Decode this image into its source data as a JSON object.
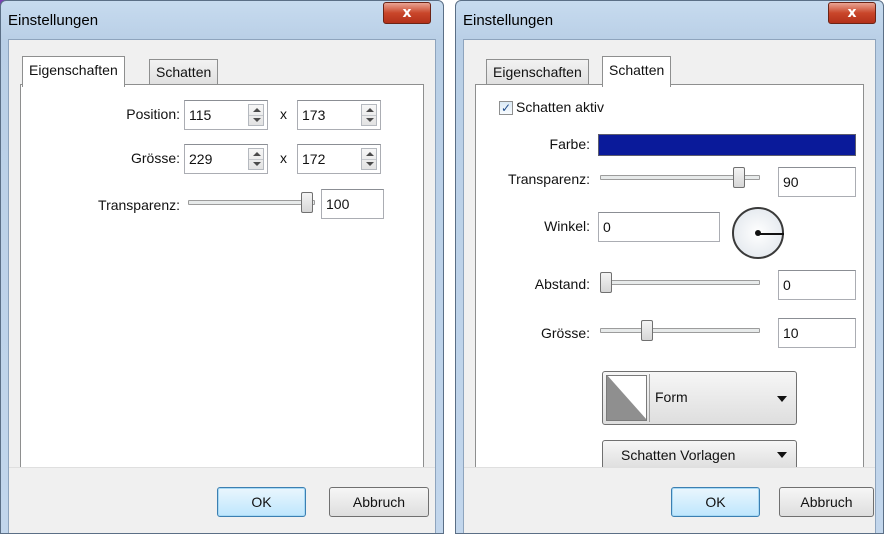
{
  "left_dialog": {
    "title": "Einstellungen",
    "close_glyph": "x",
    "tabs": [
      {
        "label": "Eigenschaften",
        "active": true
      },
      {
        "label": "Schatten",
        "active": false
      }
    ],
    "position": {
      "label": "Position:",
      "x": "115",
      "y": "173"
    },
    "size": {
      "label": "Grösse:",
      "w": "229",
      "h": "172"
    },
    "separator": "x",
    "transparency": {
      "label": "Transparenz:",
      "value": "100",
      "level": 1.0
    },
    "ok_label": "OK",
    "cancel_label": "Abbruch"
  },
  "right_dialog": {
    "title": "Einstellungen",
    "close_glyph": "x",
    "tabs": [
      {
        "label": "Eigenschaften",
        "active": false
      },
      {
        "label": "Schatten",
        "active": true
      }
    ],
    "shadow_active": {
      "label": "Schatten aktiv",
      "checked": true
    },
    "color": {
      "label": "Farbe:",
      "value": "#0a1a9a"
    },
    "transparency": {
      "label": "Transparenz:",
      "value": "90",
      "level": 0.9
    },
    "angle": {
      "label": "Winkel:",
      "value": "0"
    },
    "distance": {
      "label": "Abstand:",
      "value": "0",
      "level": 0.0
    },
    "size": {
      "label": "Grösse:",
      "value": "10",
      "level": 0.3
    },
    "form_label": "Form",
    "presets_label": "Schatten Vorlagen",
    "ok_label": "OK",
    "cancel_label": "Abbruch"
  },
  "icons": {
    "close": "close-icon",
    "spin": "spinner-arrows-icon",
    "dropdown": "chevron-down-icon",
    "check": "checkmark-icon",
    "dial": "angle-dial-icon",
    "shape": "shape-triangle-icon"
  }
}
